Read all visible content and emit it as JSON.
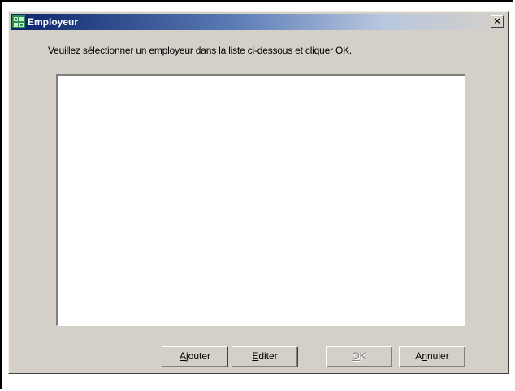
{
  "window": {
    "title": "Employeur",
    "close_glyph": "×",
    "icon": "employer-app-icon"
  },
  "dialog": {
    "instruction": "Veuillez sélectionner un employeur dans la liste ci-dessous et cliquer OK.",
    "list_items": []
  },
  "buttons": {
    "ajouter": {
      "mnemonic": "A",
      "rest": "jouter",
      "enabled": true
    },
    "editer": {
      "mnemonic": "E",
      "rest": "diter",
      "enabled": true
    },
    "ok": {
      "mnemonic": "O",
      "rest": "K",
      "enabled": false
    },
    "annuler": {
      "pre": "A",
      "mnemonic": "n",
      "rest": "nuler",
      "enabled": true
    }
  },
  "colors": {
    "titlebar_start": "#0a246a",
    "face": "#d4d0c8",
    "list_bg": "#ffffff"
  }
}
